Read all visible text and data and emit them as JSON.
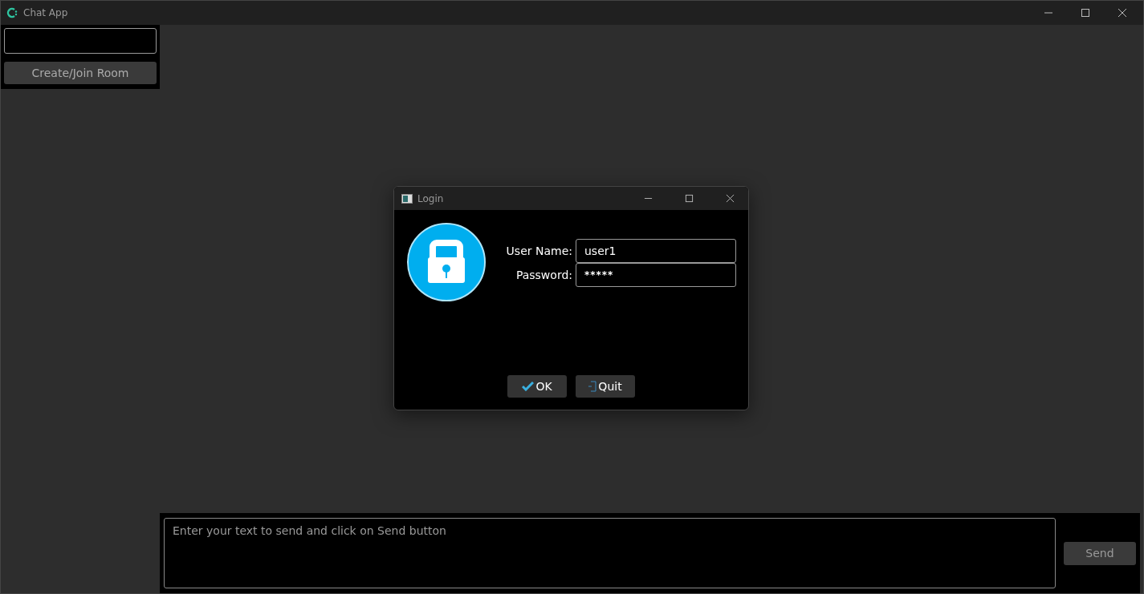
{
  "window": {
    "title": "Chat App"
  },
  "sidebar": {
    "create_button": "Create/Join Room"
  },
  "composer": {
    "placeholder": "Enter your text to send and click on Send button",
    "send_button": "Send"
  },
  "login_dialog": {
    "title": "Login",
    "fields": [
      {
        "label": "User Name:",
        "value": "user1",
        "kind": "text"
      },
      {
        "label": "Password:",
        "value": "*****",
        "kind": "password"
      }
    ],
    "buttons": [
      {
        "label": "OK",
        "kind": "ok"
      },
      {
        "label": "Quit",
        "kind": "quit"
      }
    ]
  }
}
